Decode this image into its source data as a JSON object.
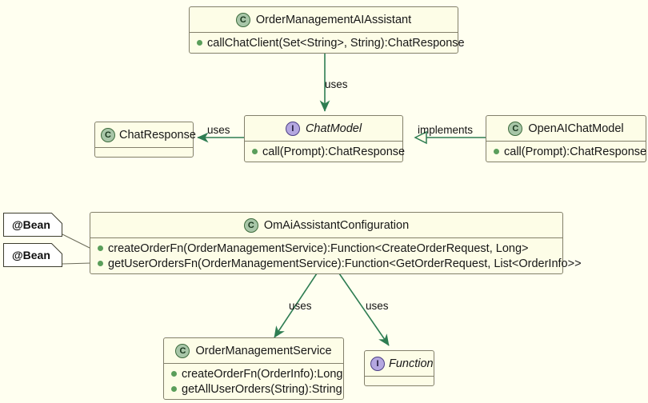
{
  "diagram": {
    "title": "UML Class Diagram",
    "background_color": "#fffff0",
    "box_fill_color": "#fdfde7",
    "box_border_color": "#83806b",
    "edge_color": "#2e7d52",
    "class_icon_label": "C",
    "interface_icon_label": "I"
  },
  "classes": {
    "assistant": {
      "name": "OrderManagementAIAssistant",
      "stereotype": "C",
      "methods": [
        "callChatClient(Set<String>, String):ChatResponse"
      ]
    },
    "chatresponse": {
      "name": "ChatResponse",
      "stereotype": "C",
      "methods": []
    },
    "chatmodel": {
      "name": "ChatModel",
      "stereotype": "I",
      "methods": [
        "call(Prompt):ChatResponse"
      ]
    },
    "openaichatmodel": {
      "name": "OpenAIChatModel",
      "stereotype": "C",
      "methods": [
        "call(Prompt):ChatResponse"
      ]
    },
    "configuration": {
      "name": "OmAiAssistantConfiguration",
      "stereotype": "C",
      "methods": [
        "createOrderFn(OrderManagementService):Function<CreateOrderRequest, Long>",
        "getUserOrdersFn(OrderManagementService):Function<GetOrderRequest, List<OrderInfo>>"
      ]
    },
    "service": {
      "name": "OrderManagementService",
      "stereotype": "C",
      "methods": [
        "createOrderFn(OrderInfo):Long",
        "getAllUserOrders(String):String"
      ]
    },
    "function": {
      "name": "Function",
      "stereotype": "I",
      "methods": []
    }
  },
  "notes": [
    {
      "text": "@Bean"
    },
    {
      "text": "@Bean"
    }
  ],
  "edges": [
    {
      "id": "assistant-uses-chatmodel",
      "label": "uses",
      "from": "OrderManagementAIAssistant",
      "to": "ChatModel",
      "type": "dependency"
    },
    {
      "id": "chatmodel-uses-chatresponse",
      "label": "uses",
      "from": "ChatModel",
      "to": "ChatResponse",
      "type": "dependency"
    },
    {
      "id": "openaichatmodel-implements-chatmodel",
      "label": "implements",
      "from": "OpenAIChatModel",
      "to": "ChatModel",
      "type": "realization"
    },
    {
      "id": "configuration-uses-service",
      "label": "uses",
      "from": "OmAiAssistantConfiguration",
      "to": "OrderManagementService",
      "type": "dependency"
    },
    {
      "id": "configuration-uses-function",
      "label": "uses",
      "from": "OmAiAssistantConfiguration",
      "to": "Function",
      "type": "dependency"
    }
  ]
}
